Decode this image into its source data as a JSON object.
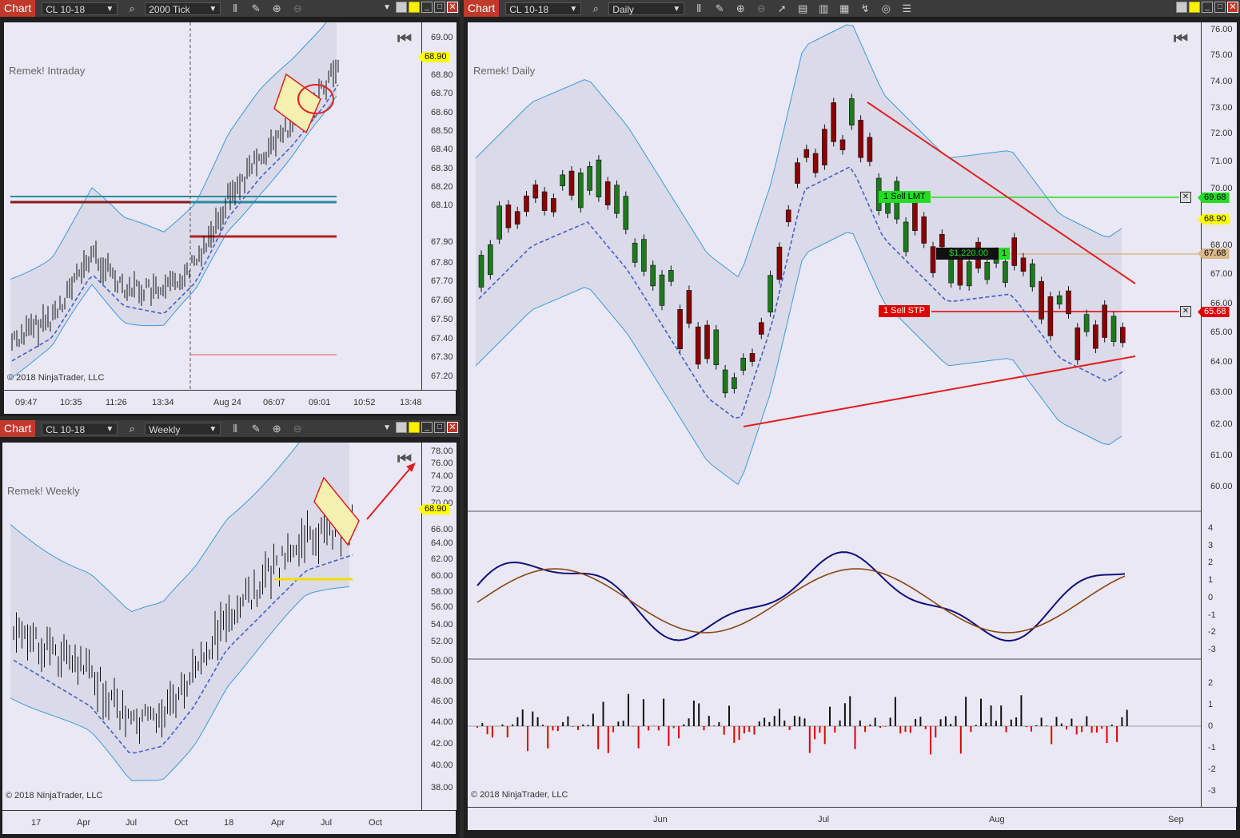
{
  "colors": {
    "title_bg": "#c0392b",
    "plot_bg": "#e9e8f4",
    "up": "#1c7a1c",
    "down": "#8b0000",
    "red": "#e02020",
    "green": "#22dd22",
    "blue": "#3a9be0"
  },
  "windows": [
    {
      "id": "intraday",
      "title": "Chart",
      "instrument": "CL 10-18",
      "period": "2000 Tick",
      "label": "Remek! Intraday",
      "copyright": "© 2018 NinjaTrader, LLC",
      "price_tag": "68.90",
      "yticks": [
        "69.00",
        "68.80",
        "68.70",
        "68.60",
        "68.50",
        "68.40",
        "68.30",
        "68.20",
        "68.10",
        "67.90",
        "67.80",
        "67.70",
        "67.60",
        "67.50",
        "67.40",
        "67.30",
        "67.20"
      ],
      "xticks": [
        "09:47",
        "10:35",
        "11:26",
        "13:34",
        "Aug 24",
        "06:07",
        "09:01",
        "10:52",
        "13:48"
      ]
    },
    {
      "id": "weekly",
      "title": "Chart",
      "instrument": "CL 10-18",
      "period": "Weekly",
      "label": "Remek! Weekly",
      "copyright": "© 2018 NinjaTrader, LLC",
      "price_tag": "68.90",
      "yticks": [
        "78.00",
        "76.00",
        "74.00",
        "72.00",
        "70.00",
        "66.00",
        "64.00",
        "62.00",
        "60.00",
        "58.00",
        "56.00",
        "54.00",
        "52.00",
        "50.00",
        "48.00",
        "46.00",
        "44.00",
        "42.00",
        "40.00",
        "38.00"
      ],
      "xticks": [
        "17",
        "Apr",
        "Jul",
        "Oct",
        "18",
        "Apr",
        "Jul",
        "Oct"
      ]
    },
    {
      "id": "daily",
      "title": "Chart",
      "instrument": "CL 10-18",
      "period": "Daily",
      "label": "Remek! Daily",
      "copyright": "© 2018 NinjaTrader, LLC",
      "price_tag": "68.90",
      "limit_tag": "69.68",
      "entry_tag": "67.68",
      "stop_tag": "65.68",
      "order_limit": "1  Sell LMT",
      "order_stop": "1  Sell STP",
      "position_pnl": "$1,220.00",
      "position_qty": "1",
      "yticks": [
        "76.00",
        "75.00",
        "74.00",
        "73.00",
        "72.00",
        "71.00",
        "70.00",
        "68.00",
        "67.00",
        "66.00",
        "65.00",
        "64.00",
        "63.00",
        "62.00",
        "61.00",
        "60.00"
      ],
      "osc_ticks": [
        "4",
        "3",
        "2",
        "1",
        "0",
        "-1",
        "-2",
        "-3"
      ],
      "hist_ticks": [
        "2",
        "1",
        "0",
        "-1",
        "-2",
        "-3"
      ],
      "xticks": [
        "Jun",
        "Jul",
        "Aug",
        "Sep"
      ]
    }
  ]
}
